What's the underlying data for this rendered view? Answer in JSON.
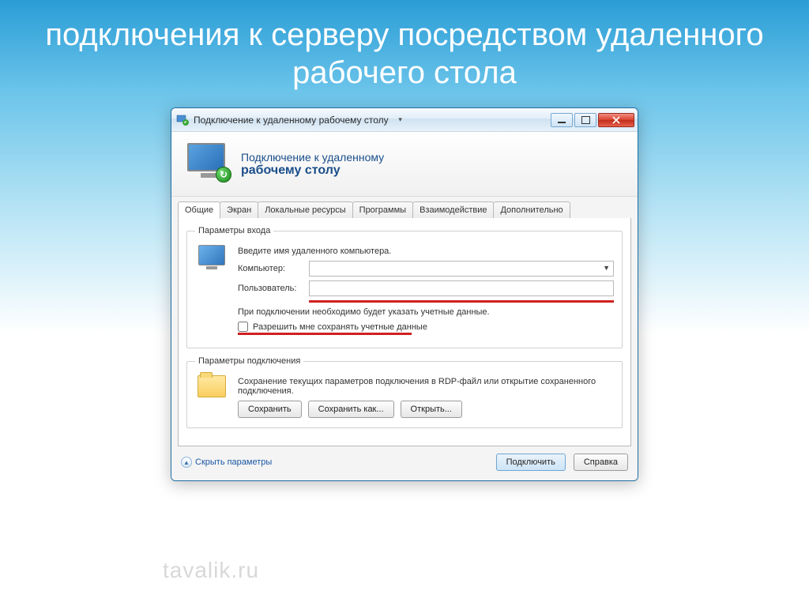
{
  "slide": {
    "title": "подключения к серверу посредством удаленного рабочего стола"
  },
  "window": {
    "title": "Подключение к удаленному рабочему столу",
    "header_line1": "Подключение к удаленному",
    "header_line2": "рабочему столу"
  },
  "tabs": {
    "general": "Общие",
    "screen": "Экран",
    "local_resources": "Локальные ресурсы",
    "programs": "Программы",
    "experience": "Взаимодействие",
    "advanced": "Дополнительно"
  },
  "login_group": {
    "legend": "Параметры входа",
    "instruction": "Введите имя удаленного компьютера.",
    "computer_label": "Компьютер:",
    "computer_value": "",
    "user_label": "Пользователь:",
    "user_value": "",
    "credentials_note": "При подключении необходимо будет указать учетные данные.",
    "save_credentials": "Разрешить мне сохранять учетные данные"
  },
  "connection_group": {
    "legend": "Параметры подключения",
    "description": "Сохранение текущих параметров подключения в RDP-файл или открытие сохраненного подключения.",
    "save": "Сохранить",
    "save_as": "Сохранить как...",
    "open": "Открыть..."
  },
  "footer": {
    "hide_params": "Скрыть параметры",
    "connect": "Подключить",
    "help": "Справка"
  },
  "watermark": "tavalik.ru"
}
